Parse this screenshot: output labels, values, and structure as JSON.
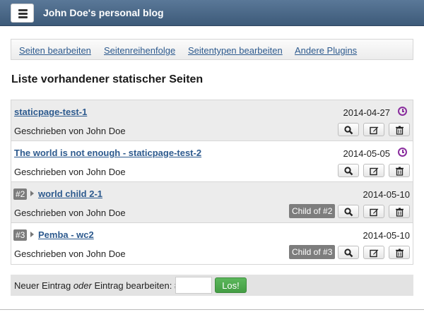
{
  "header": {
    "title": "John Doe's personal blog",
    "menu_icon": "hamburger-icon"
  },
  "nav": {
    "links": [
      "Seiten bearbeiten",
      "Seitenreihenfolge",
      "Seitentypen bearbeiten",
      "Andere Plugins"
    ]
  },
  "page_heading": "Liste vorhandener statischer Seiten",
  "entries": [
    {
      "title": "staticpage-test-1",
      "date": "2014-04-27",
      "author": "Geschrieben von John Doe",
      "draft_icon": "clock-icon"
    },
    {
      "title": "The world is not enough - staticpage-test-2",
      "date": "2014-05-05",
      "author": "Geschrieben von John Doe",
      "draft_icon": "clock-icon"
    },
    {
      "number": "#2",
      "title": "world child 2-1",
      "date": "2014-05-10",
      "author": "Geschrieben von John Doe",
      "child_badge": "Child of #2"
    },
    {
      "number": "#3",
      "title": "Pemba - wc2",
      "date": "2014-05-10",
      "author": "Geschrieben von John Doe",
      "child_badge": "Child of #3"
    }
  ],
  "actions": {
    "view_icon": "magnifier-icon",
    "edit_icon": "edit-icon",
    "delete_icon": "trash-icon"
  },
  "new_entry": {
    "label_part1": "Neuer Eintrag ",
    "label_or": "oder",
    "label_part2": " Eintrag bearbeiten: #",
    "input_value": "",
    "button_label": "Los!"
  },
  "colors": {
    "header": "#46627f",
    "link": "#2d5a8e",
    "go_button": "#4cae4c",
    "draft_clock": "#8a2e9e"
  }
}
